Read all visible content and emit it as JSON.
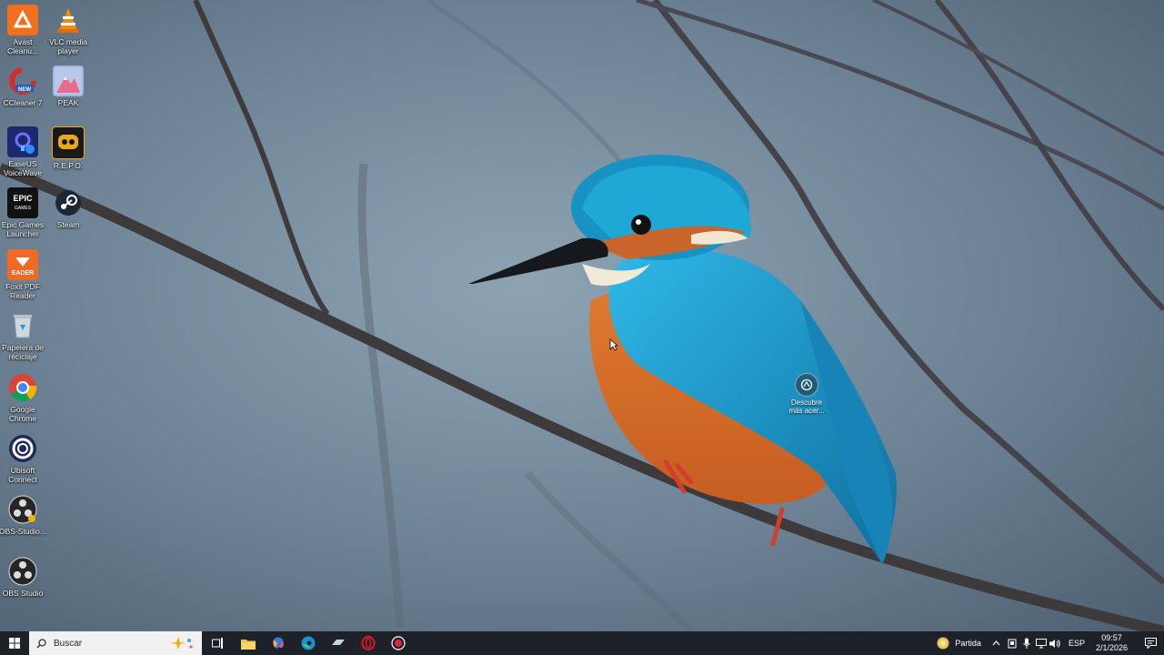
{
  "desktop": {
    "icons": [
      {
        "label": "Avast Cleanu...",
        "icon": "avast-cleanup-icon"
      },
      {
        "label": "VLC media player",
        "icon": "vlc-icon"
      },
      {
        "label": "CCleaner 7",
        "icon": "ccleaner-icon"
      },
      {
        "label": "PEAK",
        "icon": "peak-icon"
      },
      {
        "label": "EaseUS VoiceWave",
        "icon": "easeus-voicewave-icon"
      },
      {
        "label": "R.E.P.O.",
        "icon": "repo-icon"
      },
      {
        "label": "Epic Games Launcher",
        "icon": "epic-games-icon"
      },
      {
        "label": "Steam",
        "icon": "steam-icon"
      },
      {
        "label": "Foxit PDF Reader",
        "icon": "foxit-reader-icon"
      },
      {
        "label": "Papelera de reciclaje",
        "icon": "recycle-bin-icon"
      },
      {
        "label": "Google Chrome",
        "icon": "chrome-icon"
      },
      {
        "label": "Ubisoft Connect",
        "icon": "ubisoft-icon"
      },
      {
        "label": "OBS-Studio...",
        "icon": "obs-icon"
      },
      {
        "label": "OBS Studio",
        "icon": "obs-icon"
      }
    ],
    "spotlight_label": "Descubre más acer..."
  },
  "taskbar": {
    "search_placeholder": "Buscar",
    "weather_label": "Partida",
    "language": "ESP",
    "time": "09:57",
    "date": "2/1/2026"
  },
  "colors": {
    "taskbar_bg": "#1c2228",
    "search_bg": "#f1f1f1",
    "kingfisher_blue": "#1c9ad0",
    "kingfisher_orange": "#d9702c"
  }
}
